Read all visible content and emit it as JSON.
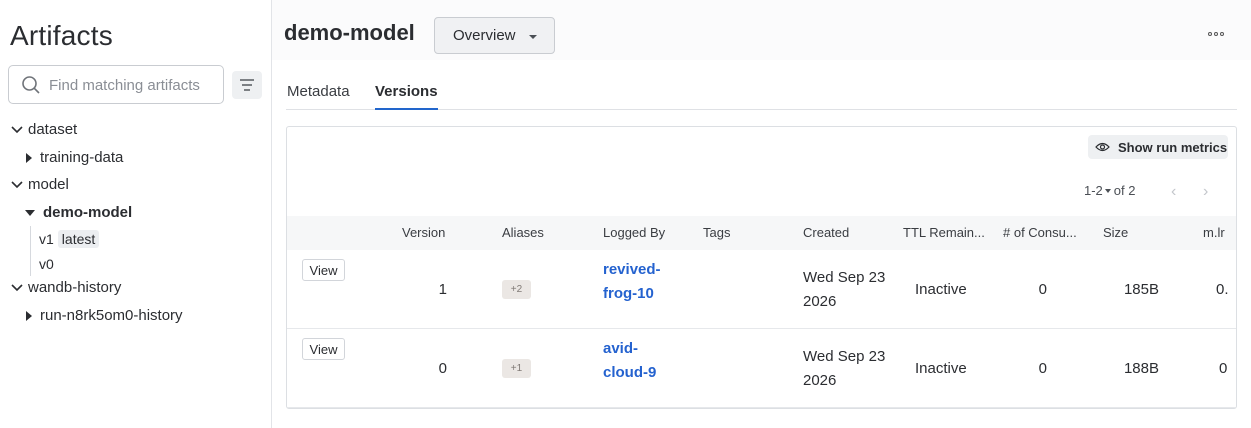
{
  "sidebar": {
    "title": "Artifacts",
    "search_placeholder": "Find matching artifacts",
    "tree": {
      "dataset": {
        "label": "dataset",
        "children": [
          "training-data"
        ]
      },
      "model": {
        "label": "model",
        "selected": "demo-model",
        "versions": [
          {
            "label": "v1",
            "alias": "latest"
          },
          {
            "label": "v0"
          }
        ]
      },
      "history": {
        "label": "wandb-history",
        "children": [
          "run-n8rk5om0-history"
        ]
      }
    }
  },
  "header": {
    "title": "demo-model",
    "view_select": "Overview"
  },
  "tabs": [
    "Metadata",
    "Versions"
  ],
  "active_tab": "Versions",
  "toolbar": {
    "show_run_metrics": "Show run metrics",
    "page_range": "1-2",
    "page_total": "of 2"
  },
  "table": {
    "columns": [
      "Version",
      "Aliases",
      "Logged By",
      "Tags",
      "Created",
      "TTL Remain...",
      "# of Consu...",
      "Size",
      "m.lr"
    ],
    "view_label": "View",
    "rows": [
      {
        "version": "1",
        "aliases": "+2",
        "logged_by": "revived-frog-10",
        "tags": "",
        "created": "Wed Sep 23 2026",
        "ttl": "Inactive",
        "consumers": "0",
        "size": "185B",
        "mlr": "0."
      },
      {
        "version": "0",
        "aliases": "+1",
        "logged_by": "avid-cloud-9",
        "tags": "",
        "created": "Wed Sep 23 2026",
        "ttl": "Inactive",
        "consumers": "0",
        "size": "188B",
        "mlr": "0"
      }
    ]
  },
  "colors": {
    "link": "#2462cf",
    "active_tab_underline": "#2266cc"
  }
}
